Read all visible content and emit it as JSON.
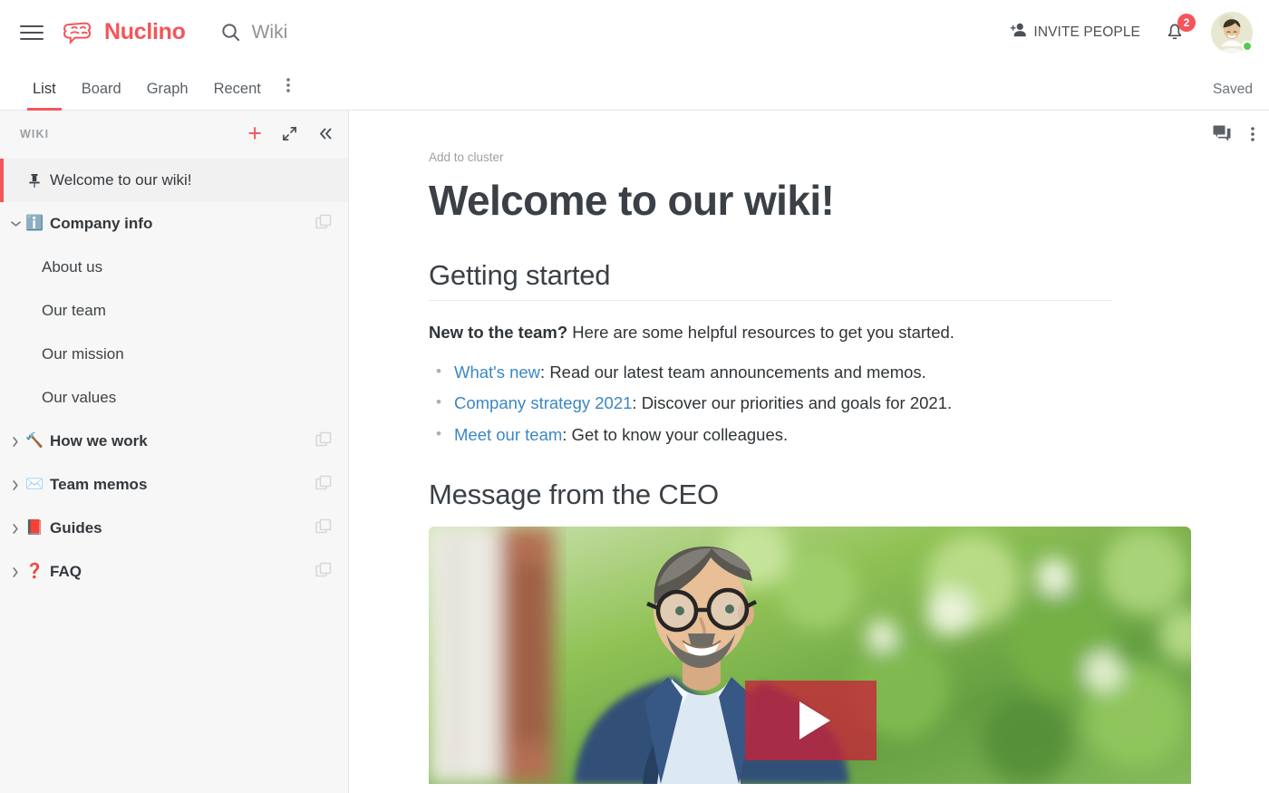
{
  "app": {
    "brand_name": "Nuclino",
    "brand_color": "#f4555a",
    "link_color": "#3b87c4"
  },
  "topbar": {
    "menu_icon": "hamburger-menu-icon",
    "logo_icon": "nuclino-brain-logo-icon",
    "search": {
      "icon": "search-icon",
      "value": "Wiki",
      "placeholder": "Search"
    },
    "invite": {
      "icon": "add-person-icon",
      "label": "INVITE PEOPLE"
    },
    "notifications": {
      "icon": "bell-icon",
      "badge_count": "2",
      "badge_color": "#f4555a"
    },
    "avatar": {
      "icon": "avatar",
      "status": "online",
      "status_color": "#56c84f"
    }
  },
  "tabbar": {
    "tabs": [
      {
        "label": "List",
        "active": true
      },
      {
        "label": "Board",
        "active": false
      },
      {
        "label": "Graph",
        "active": false
      },
      {
        "label": "Recent",
        "active": false
      }
    ],
    "more_icon": "more-vertical-icon",
    "save_status": "Saved"
  },
  "sidebar": {
    "title": "WIKI",
    "actions": [
      {
        "name": "add-item-button",
        "icon": "plus-icon"
      },
      {
        "name": "expand-button",
        "icon": "expand-icon"
      },
      {
        "name": "collapse-sidebar-button",
        "icon": "double-chevron-left-icon"
      }
    ],
    "items": [
      {
        "label": "Welcome to our wiki!",
        "emoji": "",
        "icon": "pin-icon",
        "selected": true,
        "type": "pinned-item",
        "indent": 0,
        "chevron": "",
        "cluster": false
      },
      {
        "label": "Company info",
        "emoji": "ℹ️",
        "selected": false,
        "type": "cluster",
        "indent": 0,
        "chevron": "expanded",
        "cluster": true
      },
      {
        "label": "About us",
        "emoji": "",
        "selected": false,
        "type": "item",
        "indent": 1,
        "chevron": "",
        "cluster": false
      },
      {
        "label": "Our team",
        "emoji": "",
        "selected": false,
        "type": "item",
        "indent": 1,
        "chevron": "",
        "cluster": false
      },
      {
        "label": "Our mission",
        "emoji": "",
        "selected": false,
        "type": "item",
        "indent": 1,
        "chevron": "",
        "cluster": false
      },
      {
        "label": "Our values",
        "emoji": "",
        "selected": false,
        "type": "item",
        "indent": 1,
        "chevron": "",
        "cluster": false
      },
      {
        "label": "How we work",
        "emoji": "🔨",
        "selected": false,
        "type": "cluster",
        "indent": 0,
        "chevron": "collapsed",
        "cluster": true
      },
      {
        "label": "Team memos",
        "emoji": "✉️",
        "selected": false,
        "type": "cluster",
        "indent": 0,
        "chevron": "collapsed",
        "cluster": true
      },
      {
        "label": "Guides",
        "emoji": "📕",
        "selected": false,
        "type": "cluster",
        "indent": 0,
        "chevron": "collapsed",
        "cluster": true
      },
      {
        "label": "FAQ",
        "emoji": "❓",
        "selected": false,
        "type": "cluster",
        "indent": 0,
        "chevron": "collapsed",
        "cluster": true
      }
    ]
  },
  "document": {
    "actions": [
      {
        "name": "comments-button",
        "icon": "comment-bubble-icon"
      },
      {
        "name": "document-more-button",
        "icon": "more-vertical-icon"
      }
    ],
    "add_to_cluster": "Add to cluster",
    "title": "Welcome to our wiki!",
    "sections": [
      {
        "heading": "Getting started",
        "has_rule": true,
        "intro_bold": "New to the team?",
        "intro_rest": " Here are some helpful resources to get you started.",
        "list": [
          {
            "link": "What's new",
            "rest": ": Read our latest team announcements and memos."
          },
          {
            "link": "Company strategy 2021",
            "rest": ": Discover our priorities and goals for 2021."
          },
          {
            "link": "Meet our team",
            "rest": ": Get to know your colleagues."
          }
        ]
      },
      {
        "heading": "Message from the CEO",
        "has_rule": false
      }
    ],
    "video": {
      "name": "ceo-message-video",
      "play_icon": "play-button-icon",
      "description": "Smiling bearded man with glasses in a navy blazer outdoors against blurred green foliage"
    }
  }
}
